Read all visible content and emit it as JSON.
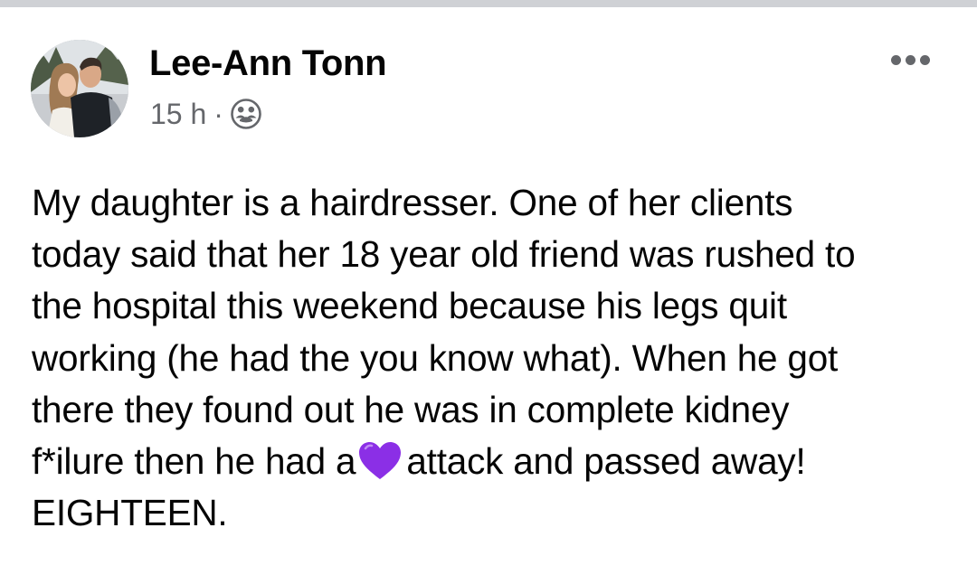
{
  "post": {
    "author": "Lee-Ann Tonn",
    "timestamp": "15 h",
    "separator": "·",
    "audience_icon": "friends-icon",
    "more_icon": "more-options-icon",
    "text": {
      "line1": "My daughter is a hairdresser. One of her clients",
      "line2": "today said that her 18 year old friend was rushed to",
      "line3": "the hospital this weekend because his legs quit",
      "line4": "working (he had the you know what). When he got",
      "line5": "there they found out he was in complete kidney",
      "line6_before": "f*ilure then he had a",
      "line6_emoji": "purple-heart-emoji",
      "line6_after": "attack and passed away!",
      "line7": "EIGHTEEN."
    }
  },
  "colors": {
    "text": "#050505",
    "meta": "#65676b",
    "heart": "#8b2fe6",
    "top_strip": "#cfd1d5"
  }
}
